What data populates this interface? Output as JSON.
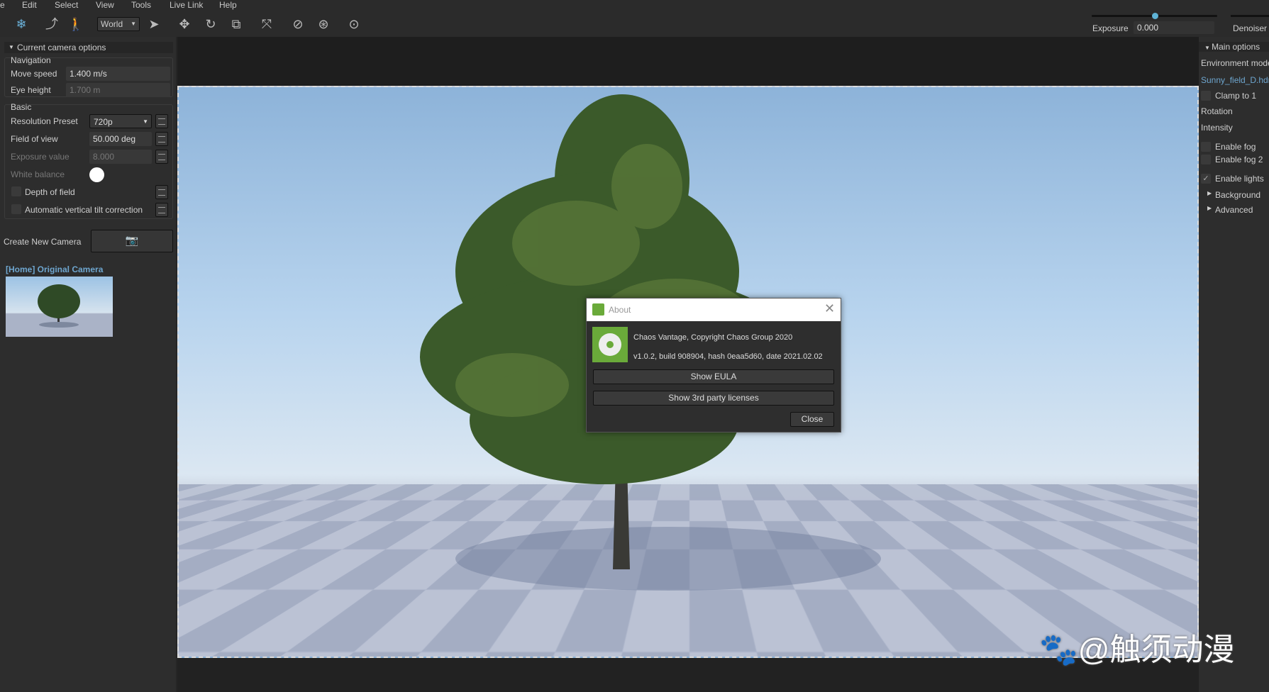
{
  "menu": [
    "e",
    "Edit",
    "Select",
    "View",
    "Tools",
    "Live Link",
    "Help"
  ],
  "toolbar": {
    "space": "World",
    "icons": [
      "scene-icon",
      "path-icon",
      "walk-icon",
      "select-icon",
      "move-icon",
      "rotate-icon",
      "scale-icon",
      "axis-icon",
      "orbit-icon",
      "mouse-icon",
      "target-icon"
    ]
  },
  "render_controls": {
    "exposure_label": "Exposure",
    "exposure_value": "0.000",
    "exposure_slider": 0.5,
    "denoiser_label": "Denoiser"
  },
  "left_panel": {
    "header": "Current camera options",
    "navigation": {
      "title": "Navigation",
      "move_speed_label": "Move speed",
      "move_speed": "1.400 m/s",
      "eye_height_label": "Eye height",
      "eye_height": "1.700 m"
    },
    "basic": {
      "title": "Basic",
      "resolution_label": "Resolution Preset",
      "resolution": "720p",
      "fov_label": "Field of view",
      "fov": "50.000 deg",
      "exposure_label": "Exposure value",
      "exposure": "8.000",
      "white_balance_label": "White balance",
      "white_balance_color": "#ffffff",
      "dof_label": "Depth of field",
      "tilt_label": "Automatic vertical tilt correction"
    },
    "create_camera_label": "Create New Camera",
    "camera_name": "[Home] Original Camera"
  },
  "right_panel": {
    "header": "Main options",
    "env_mode_label": "Environment mode",
    "env_file": "Sunny_field_D.hdr",
    "clamp_label": "Clamp to 1",
    "rotation_label": "Rotation",
    "intensity_label": "Intensity",
    "fog_label": "Enable fog",
    "fog2_label": "Enable fog 2",
    "lights_label": "Enable lights",
    "lights_checked": true,
    "background_label": "Background",
    "advanced_label": "Advanced"
  },
  "dialog": {
    "title": "About",
    "line1": "Chaos Vantage, Copyright Chaos Group 2020",
    "line2": "v1.0.2, build 908904, hash 0eaa5d60, date 2021.02.02",
    "eula": "Show EULA",
    "licenses": "Show 3rd party licenses",
    "close": "Close",
    "logo_color": "#6aaa3a"
  },
  "watermark": "@触须动漫"
}
